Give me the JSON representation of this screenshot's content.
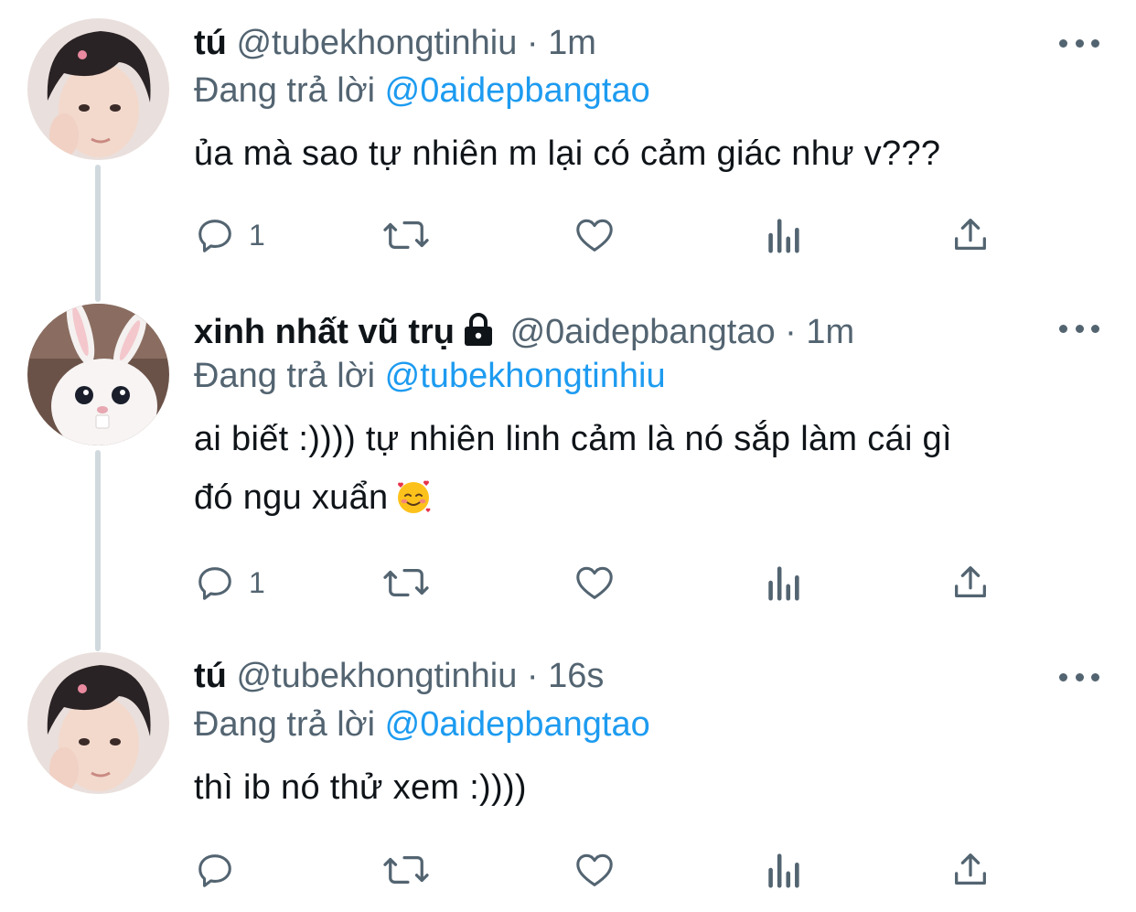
{
  "tweets": [
    {
      "name": "tú",
      "handle": "@tubekhongtinhiu",
      "separator": "·",
      "time": "1m",
      "reply_prefix": "Đang trả lời",
      "reply_to": "@0aidepbangtao",
      "text": "ủa mà sao tự nhiên m lại có cảm giác như v???",
      "reply_count": "1",
      "avatar": "boy-avatar",
      "locked": false
    },
    {
      "name": "xinh nhất vũ trụ",
      "handle": "@0aidepbangtao",
      "separator": "·",
      "time": "1m",
      "reply_prefix": "Đang trả lời",
      "reply_to": "@tubekhongtinhiu",
      "text_line1": "ai biết :)))) tự nhiên linh cảm là nó sắp làm cái gì",
      "text_line2": "đó ngu xuẩn",
      "emoji": "smiling-face-with-hearts-emoji",
      "reply_count": "1",
      "avatar": "bunny-avatar",
      "locked": true
    },
    {
      "name": "tú",
      "handle": "@tubekhongtinhiu",
      "separator": "·",
      "time": "16s",
      "reply_prefix": "Đang trả lời",
      "reply_to": "@0aidepbangtao",
      "text": "thì ib nó thử xem :))))",
      "reply_count": "",
      "avatar": "boy-avatar",
      "locked": false
    }
  ],
  "icons": [
    "reply-icon",
    "retweet-icon",
    "like-icon",
    "analytics-icon",
    "share-icon",
    "more-icon",
    "lock-icon"
  ],
  "colors": {
    "name": "#0f1419",
    "secondary": "#536471",
    "mention": "#1d9bf0",
    "thread_line": "#cfd9de"
  }
}
